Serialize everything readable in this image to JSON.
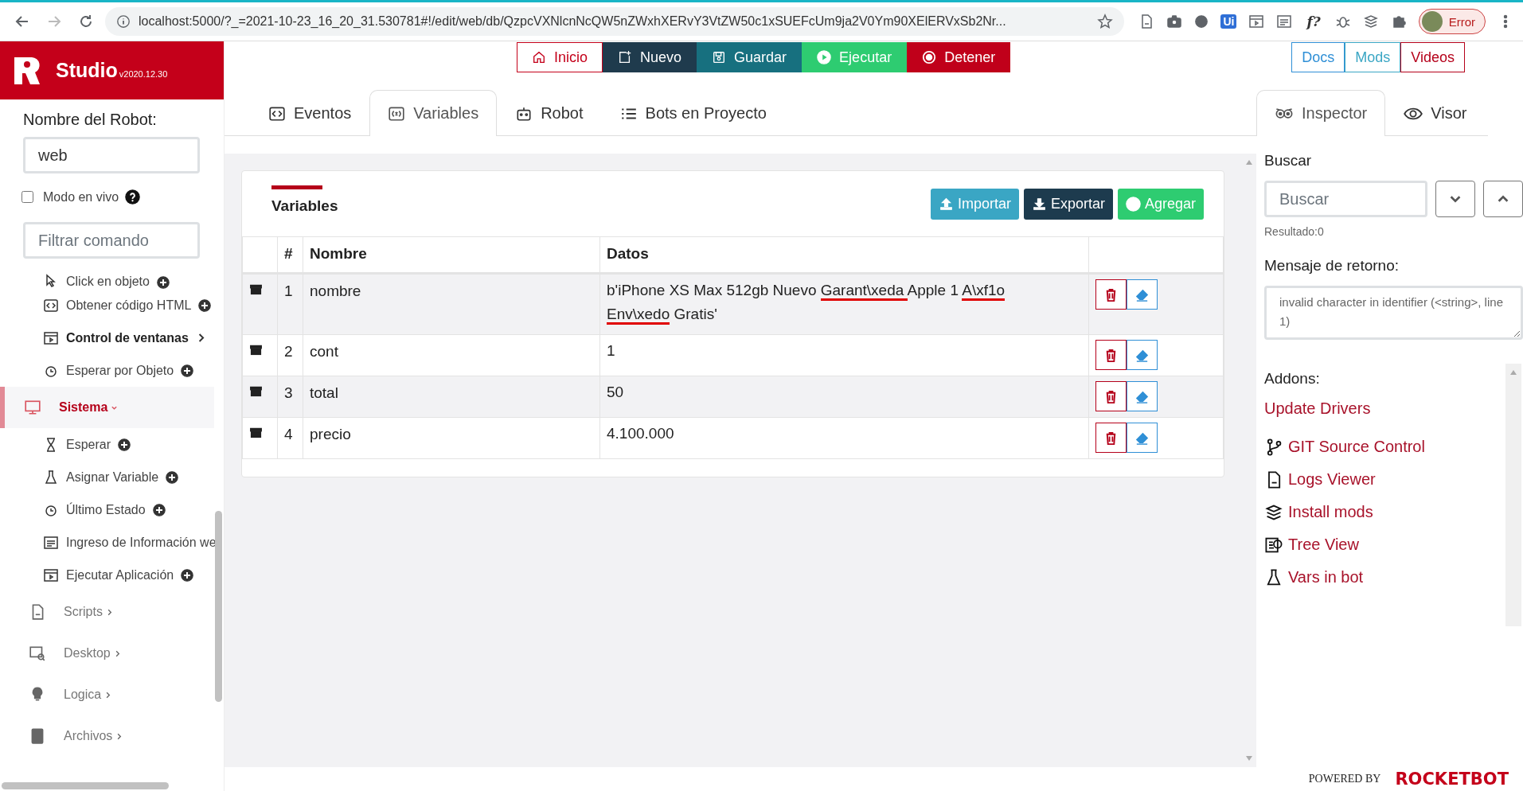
{
  "browser": {
    "url": "localhost:5000/?_=2021-10-23_16_20_31.530781#!/edit/web/db/QzpcVXNlcnNcQW5nZWxhXERvY3VtZW50c1xSUEFcUm9ja2V0Ym90XElERVxSb2Nr...",
    "extension_labels": [
      "Ui",
      "f?"
    ],
    "profile_label": "Error"
  },
  "app": {
    "name": "Studio",
    "version": "v2020.12.30"
  },
  "sidebar": {
    "robot_name_label": "Nombre del Robot:",
    "robot_name_value": "web",
    "live_mode": {
      "label": "Modo en vivo",
      "checked": false
    },
    "filter_placeholder": "Filtrar comando",
    "items": [
      {
        "kind": "command",
        "label": "Click en objeto",
        "plus": true
      },
      {
        "kind": "command",
        "label": "Obtener código HTML",
        "plus": true
      },
      {
        "kind": "group",
        "label": "Control de ventanas"
      },
      {
        "kind": "command",
        "label": "Esperar por Objeto",
        "plus": true
      },
      {
        "kind": "category",
        "label": "Sistema",
        "selected": true,
        "expanded": true,
        "children": [
          {
            "kind": "command",
            "label": "Esperar",
            "plus": true
          },
          {
            "kind": "command",
            "label": "Asignar Variable",
            "plus": true
          },
          {
            "kind": "command",
            "label": "Último Estado",
            "plus": true
          },
          {
            "kind": "command",
            "label": "Ingreso de Información we"
          },
          {
            "kind": "command",
            "label": "Ejecutar Aplicación",
            "plus": true
          }
        ]
      },
      {
        "kind": "category",
        "label": "Scripts",
        "selected": false,
        "expanded": false
      },
      {
        "kind": "category",
        "label": "Desktop",
        "selected": false,
        "expanded": false
      },
      {
        "kind": "category",
        "label": "Logica",
        "selected": false,
        "expanded": false
      },
      {
        "kind": "category",
        "label": "Archivos",
        "selected": false,
        "expanded": false
      }
    ]
  },
  "toolbar": [
    {
      "label": "Inicio",
      "kind": "home"
    },
    {
      "label": "Nuevo",
      "kind": "new"
    },
    {
      "label": "Guardar",
      "kind": "save"
    },
    {
      "label": "Ejecutar",
      "kind": "run"
    },
    {
      "label": "Detener",
      "kind": "stop"
    }
  ],
  "help_links": [
    {
      "label": "Docs",
      "color": "#2f8fd6"
    },
    {
      "label": "Mods",
      "color": "#3aa6c4"
    },
    {
      "label": "Videos",
      "color": "#b5001a"
    }
  ],
  "tabs": [
    {
      "label": "Eventos",
      "selected": false
    },
    {
      "label": "Variables",
      "selected": true
    },
    {
      "label": "Robot",
      "selected": false
    },
    {
      "label": "Bots en Proyecto",
      "selected": false
    }
  ],
  "panel_tabs": [
    {
      "label": "Inspector",
      "selected": true
    },
    {
      "label": "Visor",
      "selected": false
    }
  ],
  "variables": {
    "title": "Variables",
    "actions": [
      {
        "label": "Importar",
        "kind": "import"
      },
      {
        "label": "Exportar",
        "kind": "export"
      },
      {
        "label": "Agregar",
        "kind": "add"
      }
    ],
    "columns": [
      "#",
      "Nombre",
      "Datos"
    ],
    "rows": [
      {
        "number": "1",
        "name": "nombre",
        "data": [
          {
            "text": "b'iPhone XS Max 512gb Nuevo ",
            "underlined": false
          },
          {
            "text": "Garant\\xeda ",
            "underlined": true
          },
          {
            "text": "Apple 1 ",
            "underlined": false
          },
          {
            "text": "A\\xf1o ",
            "underlined": true
          },
          {
            "text": "Env\\xedo",
            "underlined": true
          },
          {
            "text": " Gratis'",
            "underlined": false
          }
        ]
      },
      {
        "number": "2",
        "name": "cont",
        "data": [
          {
            "text": "1",
            "underlined": false
          }
        ]
      },
      {
        "number": "3",
        "name": "total",
        "data": [
          {
            "text": "50",
            "underlined": false
          }
        ]
      },
      {
        "number": "4",
        "name": "precio",
        "data": [
          {
            "text": "4.100.000",
            "underlined": false
          }
        ]
      }
    ]
  },
  "inspector": {
    "search_label": "Buscar",
    "search_placeholder": "Buscar",
    "result": "Resultado:0",
    "return_label": "Mensaje de retorno:",
    "return_message": "invalid character in identifier (<string>, line 1)",
    "addons_label": "Addons:",
    "addons": [
      {
        "label": "Update Drivers"
      },
      {
        "label": "GIT Source Control"
      },
      {
        "label": "Logs Viewer"
      },
      {
        "label": "Install mods"
      },
      {
        "label": "Tree View"
      },
      {
        "label": "Vars in bot"
      }
    ]
  },
  "footer": {
    "powered_by": "POWERED BY",
    "brand": "ROCKETBOT"
  }
}
